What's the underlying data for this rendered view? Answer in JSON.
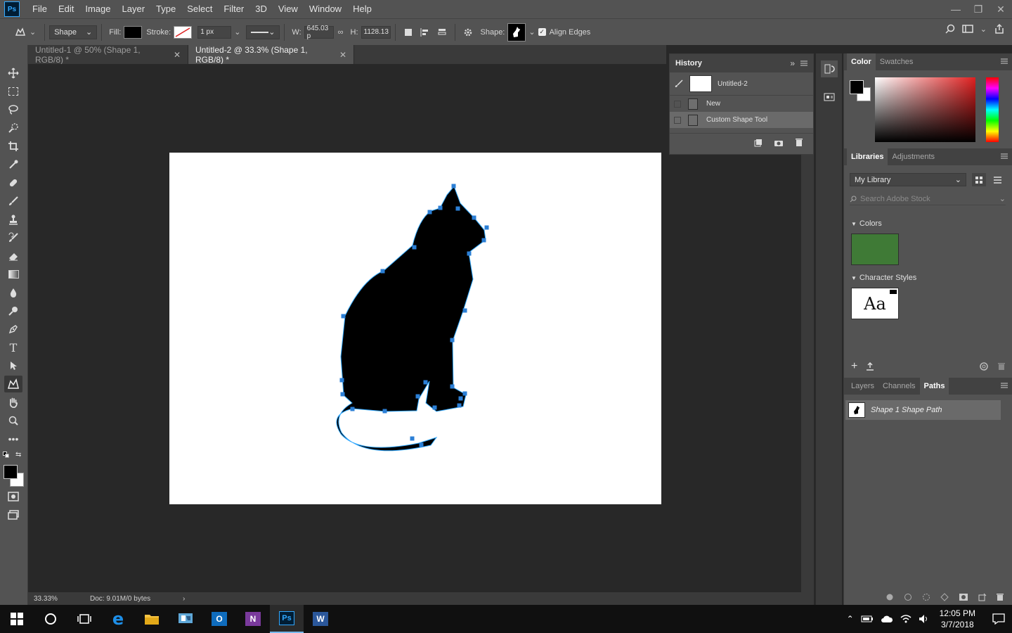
{
  "app": {
    "logo_text": "Ps",
    "menu": [
      "File",
      "Edit",
      "Image",
      "Layer",
      "Type",
      "Select",
      "Filter",
      "3D",
      "View",
      "Window",
      "Help"
    ]
  },
  "options": {
    "mode_value": "Shape",
    "fill_label": "Fill:",
    "stroke_label": "Stroke:",
    "stroke_width": "1 px",
    "w_label": "W:",
    "w_value": "645.03 p",
    "h_label": "H:",
    "h_value": "1128.13",
    "shape_label": "Shape:",
    "align_edges_label": "Align Edges",
    "align_edges_checked": true
  },
  "tabs": [
    {
      "label": "Untitled-1 @ 50% (Shape 1, RGB/8) *",
      "active": false
    },
    {
      "label": "Untitled-2 @ 33.3% (Shape 1, RGB/8) *",
      "active": true
    }
  ],
  "history": {
    "title": "History",
    "snapshot_label": "Untitled-2",
    "items": [
      {
        "label": "New",
        "selected": false
      },
      {
        "label": "Custom Shape Tool",
        "selected": true
      }
    ]
  },
  "color_panel": {
    "tabs": [
      "Color",
      "Swatches"
    ],
    "foreground": "#000000",
    "background": "#ffffff"
  },
  "libraries": {
    "tabs": [
      "Libraries",
      "Adjustments"
    ],
    "library_name": "My Library",
    "search_placeholder": "Search Adobe Stock",
    "colors_heading": "Colors",
    "color_swatch": "#3f7a36",
    "char_styles_heading": "Character Styles",
    "char_style_sample": "Aa"
  },
  "paths_panel": {
    "tabs": [
      "Layers",
      "Channels",
      "Paths"
    ],
    "path_name": "Shape 1 Shape Path"
  },
  "status": {
    "zoom": "33.33%",
    "doc_info": "Doc: 9.01M/0 bytes"
  },
  "taskbar": {
    "time": "12:05 PM",
    "date": "3/7/2018"
  }
}
